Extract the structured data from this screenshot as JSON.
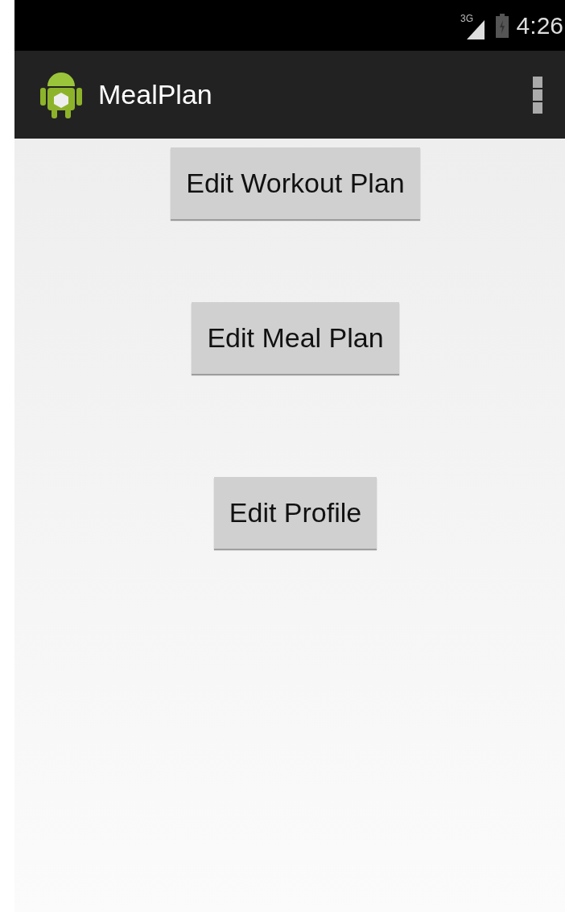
{
  "status_bar": {
    "network": "3G",
    "time": "4:26"
  },
  "action_bar": {
    "title": "MealPlan"
  },
  "buttons": [
    {
      "label": "Edit Workout Plan"
    },
    {
      "label": "Edit Meal Plan"
    },
    {
      "label": "Edit Profile"
    }
  ]
}
